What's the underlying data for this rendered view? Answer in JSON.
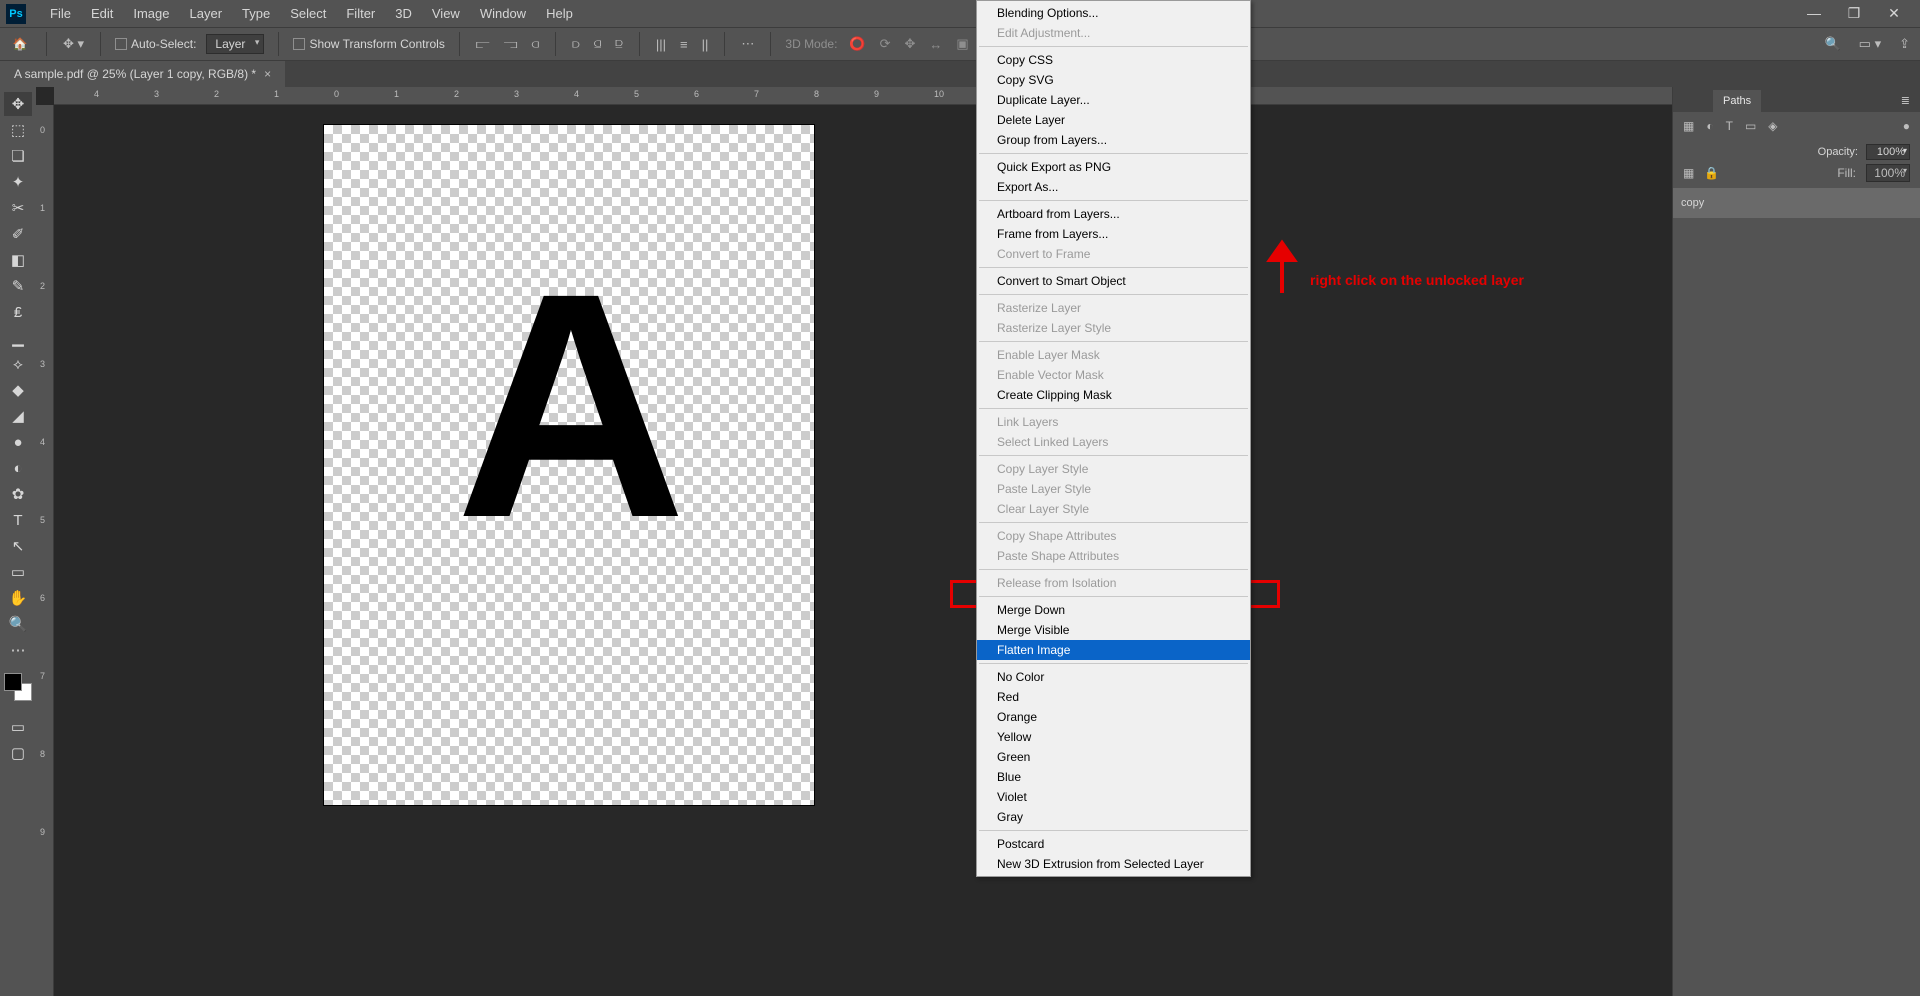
{
  "menubar": {
    "items": [
      "File",
      "Edit",
      "Image",
      "Layer",
      "Type",
      "Select",
      "Filter",
      "3D",
      "View",
      "Window",
      "Help"
    ]
  },
  "optionsbar": {
    "auto_select": "Auto-Select:",
    "layer_dd": "Layer",
    "show_tc": "Show Transform Controls",
    "threeD": "3D Mode:"
  },
  "document": {
    "tab_title": "A sample.pdf @ 25% (Layer 1 copy, RGB/8) *",
    "letter": "A"
  },
  "ruler_h": [
    "4",
    "3",
    "2",
    "1",
    "0",
    "1",
    "2",
    "3",
    "4",
    "5",
    "6",
    "7",
    "8",
    "9",
    "10"
  ],
  "ruler_v": [
    "0",
    "1",
    "2",
    "3",
    "4",
    "5",
    "6",
    "7",
    "8",
    "9"
  ],
  "panels": {
    "tabs": [
      "",
      "",
      "Paths"
    ],
    "opacity_label": "Opacity:",
    "opacity_value": "100%",
    "fill_label": "Fill:",
    "fill_value": "100%",
    "layer_name": "copy"
  },
  "context_menu": {
    "groups": [
      [
        {
          "t": "Blending Options...",
          "d": false
        },
        {
          "t": "Edit Adjustment...",
          "d": true
        }
      ],
      [
        {
          "t": "Copy CSS",
          "d": false
        },
        {
          "t": "Copy SVG",
          "d": false
        },
        {
          "t": "Duplicate Layer...",
          "d": false
        },
        {
          "t": "Delete Layer",
          "d": false
        },
        {
          "t": "Group from Layers...",
          "d": false
        }
      ],
      [
        {
          "t": "Quick Export as PNG",
          "d": false
        },
        {
          "t": "Export As...",
          "d": false
        }
      ],
      [
        {
          "t": "Artboard from Layers...",
          "d": false
        },
        {
          "t": "Frame from Layers...",
          "d": false
        },
        {
          "t": "Convert to Frame",
          "d": true
        }
      ],
      [
        {
          "t": "Convert to Smart Object",
          "d": false
        }
      ],
      [
        {
          "t": "Rasterize Layer",
          "d": true
        },
        {
          "t": "Rasterize Layer Style",
          "d": true
        }
      ],
      [
        {
          "t": "Enable Layer Mask",
          "d": true
        },
        {
          "t": "Enable Vector Mask",
          "d": true
        },
        {
          "t": "Create Clipping Mask",
          "d": false
        }
      ],
      [
        {
          "t": "Link Layers",
          "d": true
        },
        {
          "t": "Select Linked Layers",
          "d": true
        }
      ],
      [
        {
          "t": "Copy Layer Style",
          "d": true
        },
        {
          "t": "Paste Layer Style",
          "d": true
        },
        {
          "t": "Clear Layer Style",
          "d": true
        }
      ],
      [
        {
          "t": "Copy Shape Attributes",
          "d": true
        },
        {
          "t": "Paste Shape Attributes",
          "d": true
        }
      ],
      [
        {
          "t": "Release from Isolation",
          "d": true
        }
      ],
      [
        {
          "t": "Merge Down",
          "d": false
        },
        {
          "t": "Merge Visible",
          "d": false
        },
        {
          "t": "Flatten Image",
          "d": false,
          "hl": true
        }
      ],
      [
        {
          "t": "No Color",
          "d": false
        },
        {
          "t": "Red",
          "d": false
        },
        {
          "t": "Orange",
          "d": false
        },
        {
          "t": "Yellow",
          "d": false
        },
        {
          "t": "Green",
          "d": false
        },
        {
          "t": "Blue",
          "d": false
        },
        {
          "t": "Violet",
          "d": false
        },
        {
          "t": "Gray",
          "d": false
        }
      ],
      [
        {
          "t": "Postcard",
          "d": false
        },
        {
          "t": "New 3D Extrusion from Selected Layer",
          "d": false
        }
      ]
    ]
  },
  "annotation": {
    "text": "right click on the unlocked layer"
  },
  "tool_icons": [
    "✥",
    "⬚",
    "❏",
    "✦",
    "✂",
    "✐",
    "◧",
    "✎",
    "₤",
    "▁",
    "⟡",
    "◆",
    "◢",
    "●",
    "◐",
    "✿",
    "T",
    "↖",
    "▭",
    "✋",
    "🔍",
    "⋯"
  ]
}
